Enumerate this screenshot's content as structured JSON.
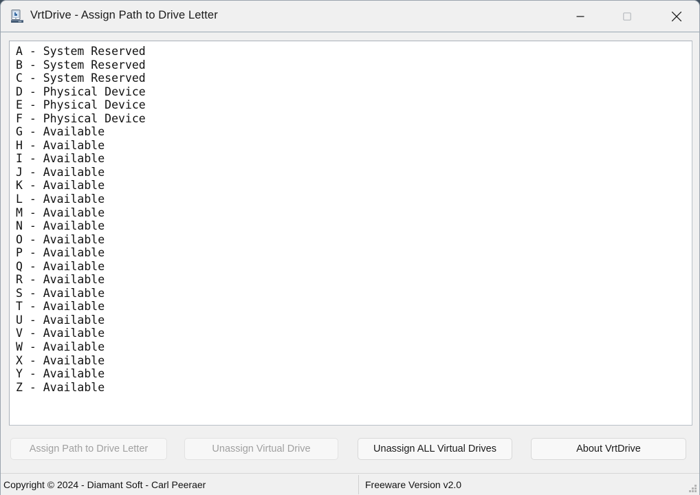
{
  "window": {
    "title": "VrtDrive - Assign Path to Drive Letter",
    "icon": "drive-computer-icon",
    "controls": {
      "minimize": "minimize-icon",
      "maximize": "maximize-icon",
      "close": "close-icon"
    }
  },
  "drive_list": [
    {
      "letter": "A",
      "separator": "-",
      "status": "System Reserved",
      "text": "A - System Reserved"
    },
    {
      "letter": "B",
      "separator": "-",
      "status": "System Reserved",
      "text": "B - System Reserved"
    },
    {
      "letter": "C",
      "separator": "-",
      "status": "System Reserved",
      "text": "C - System Reserved"
    },
    {
      "letter": "D",
      "separator": "-",
      "status": "Physical Device",
      "text": "D - Physical Device"
    },
    {
      "letter": "E",
      "separator": "-",
      "status": "Physical Device",
      "text": "E - Physical Device"
    },
    {
      "letter": "F",
      "separator": "-",
      "status": "Physical Device",
      "text": "F - Physical Device"
    },
    {
      "letter": "G",
      "separator": "-",
      "status": "Available",
      "text": "G - Available"
    },
    {
      "letter": "H",
      "separator": "-",
      "status": "Available",
      "text": "H - Available"
    },
    {
      "letter": "I",
      "separator": "-",
      "status": "Available",
      "text": "I - Available"
    },
    {
      "letter": "J",
      "separator": "-",
      "status": "Available",
      "text": "J - Available"
    },
    {
      "letter": "K",
      "separator": "-",
      "status": "Available",
      "text": "K - Available"
    },
    {
      "letter": "L",
      "separator": "-",
      "status": "Available",
      "text": "L - Available"
    },
    {
      "letter": "M",
      "separator": "-",
      "status": "Available",
      "text": "M - Available"
    },
    {
      "letter": "N",
      "separator": "-",
      "status": "Available",
      "text": "N - Available"
    },
    {
      "letter": "O",
      "separator": "-",
      "status": "Available",
      "text": "O - Available"
    },
    {
      "letter": "P",
      "separator": "-",
      "status": "Available",
      "text": "P - Available"
    },
    {
      "letter": "Q",
      "separator": "-",
      "status": "Available",
      "text": "Q - Available"
    },
    {
      "letter": "R",
      "separator": "-",
      "status": "Available",
      "text": "R - Available"
    },
    {
      "letter": "S",
      "separator": "-",
      "status": "Available",
      "text": "S - Available"
    },
    {
      "letter": "T",
      "separator": "-",
      "status": "Available",
      "text": "T - Available"
    },
    {
      "letter": "U",
      "separator": "-",
      "status": "Available",
      "text": "U - Available"
    },
    {
      "letter": "V",
      "separator": "-",
      "status": "Available",
      "text": "V - Available"
    },
    {
      "letter": "W",
      "separator": "-",
      "status": "Available",
      "text": "W - Available"
    },
    {
      "letter": "X",
      "separator": "-",
      "status": "Available",
      "text": "X - Available"
    },
    {
      "letter": "Y",
      "separator": "-",
      "status": "Available",
      "text": "Y - Available"
    },
    {
      "letter": "Z",
      "separator": "-",
      "status": "Available",
      "text": "Z - Available"
    }
  ],
  "buttons": [
    {
      "id": "assign-path",
      "label": "Assign Path to Drive Letter",
      "enabled": false
    },
    {
      "id": "unassign-virtual-drive",
      "label": "Unassign Virtual Drive",
      "enabled": false
    },
    {
      "id": "unassign-all-virtual-drives",
      "label": "Unassign ALL Virtual Drives",
      "enabled": true
    },
    {
      "id": "about-vrtdrive",
      "label": "About VrtDrive",
      "enabled": true
    }
  ],
  "statusbar": {
    "left": "Copyright © 2024 - Diamant Soft - Carl Peeraer",
    "right": "Freeware Version v2.0",
    "grip": "resize-grip-icon"
  },
  "colors": {
    "window_bg": "#f0f0f0",
    "list_bg": "#ffffff",
    "list_border": "#a9b0b8",
    "text": "#111111",
    "disabled_text": "#a0a0a0",
    "button_bg": "#f8f8f8",
    "button_border": "#d8d8d8",
    "titlebar_border": "#9aa7b3"
  }
}
